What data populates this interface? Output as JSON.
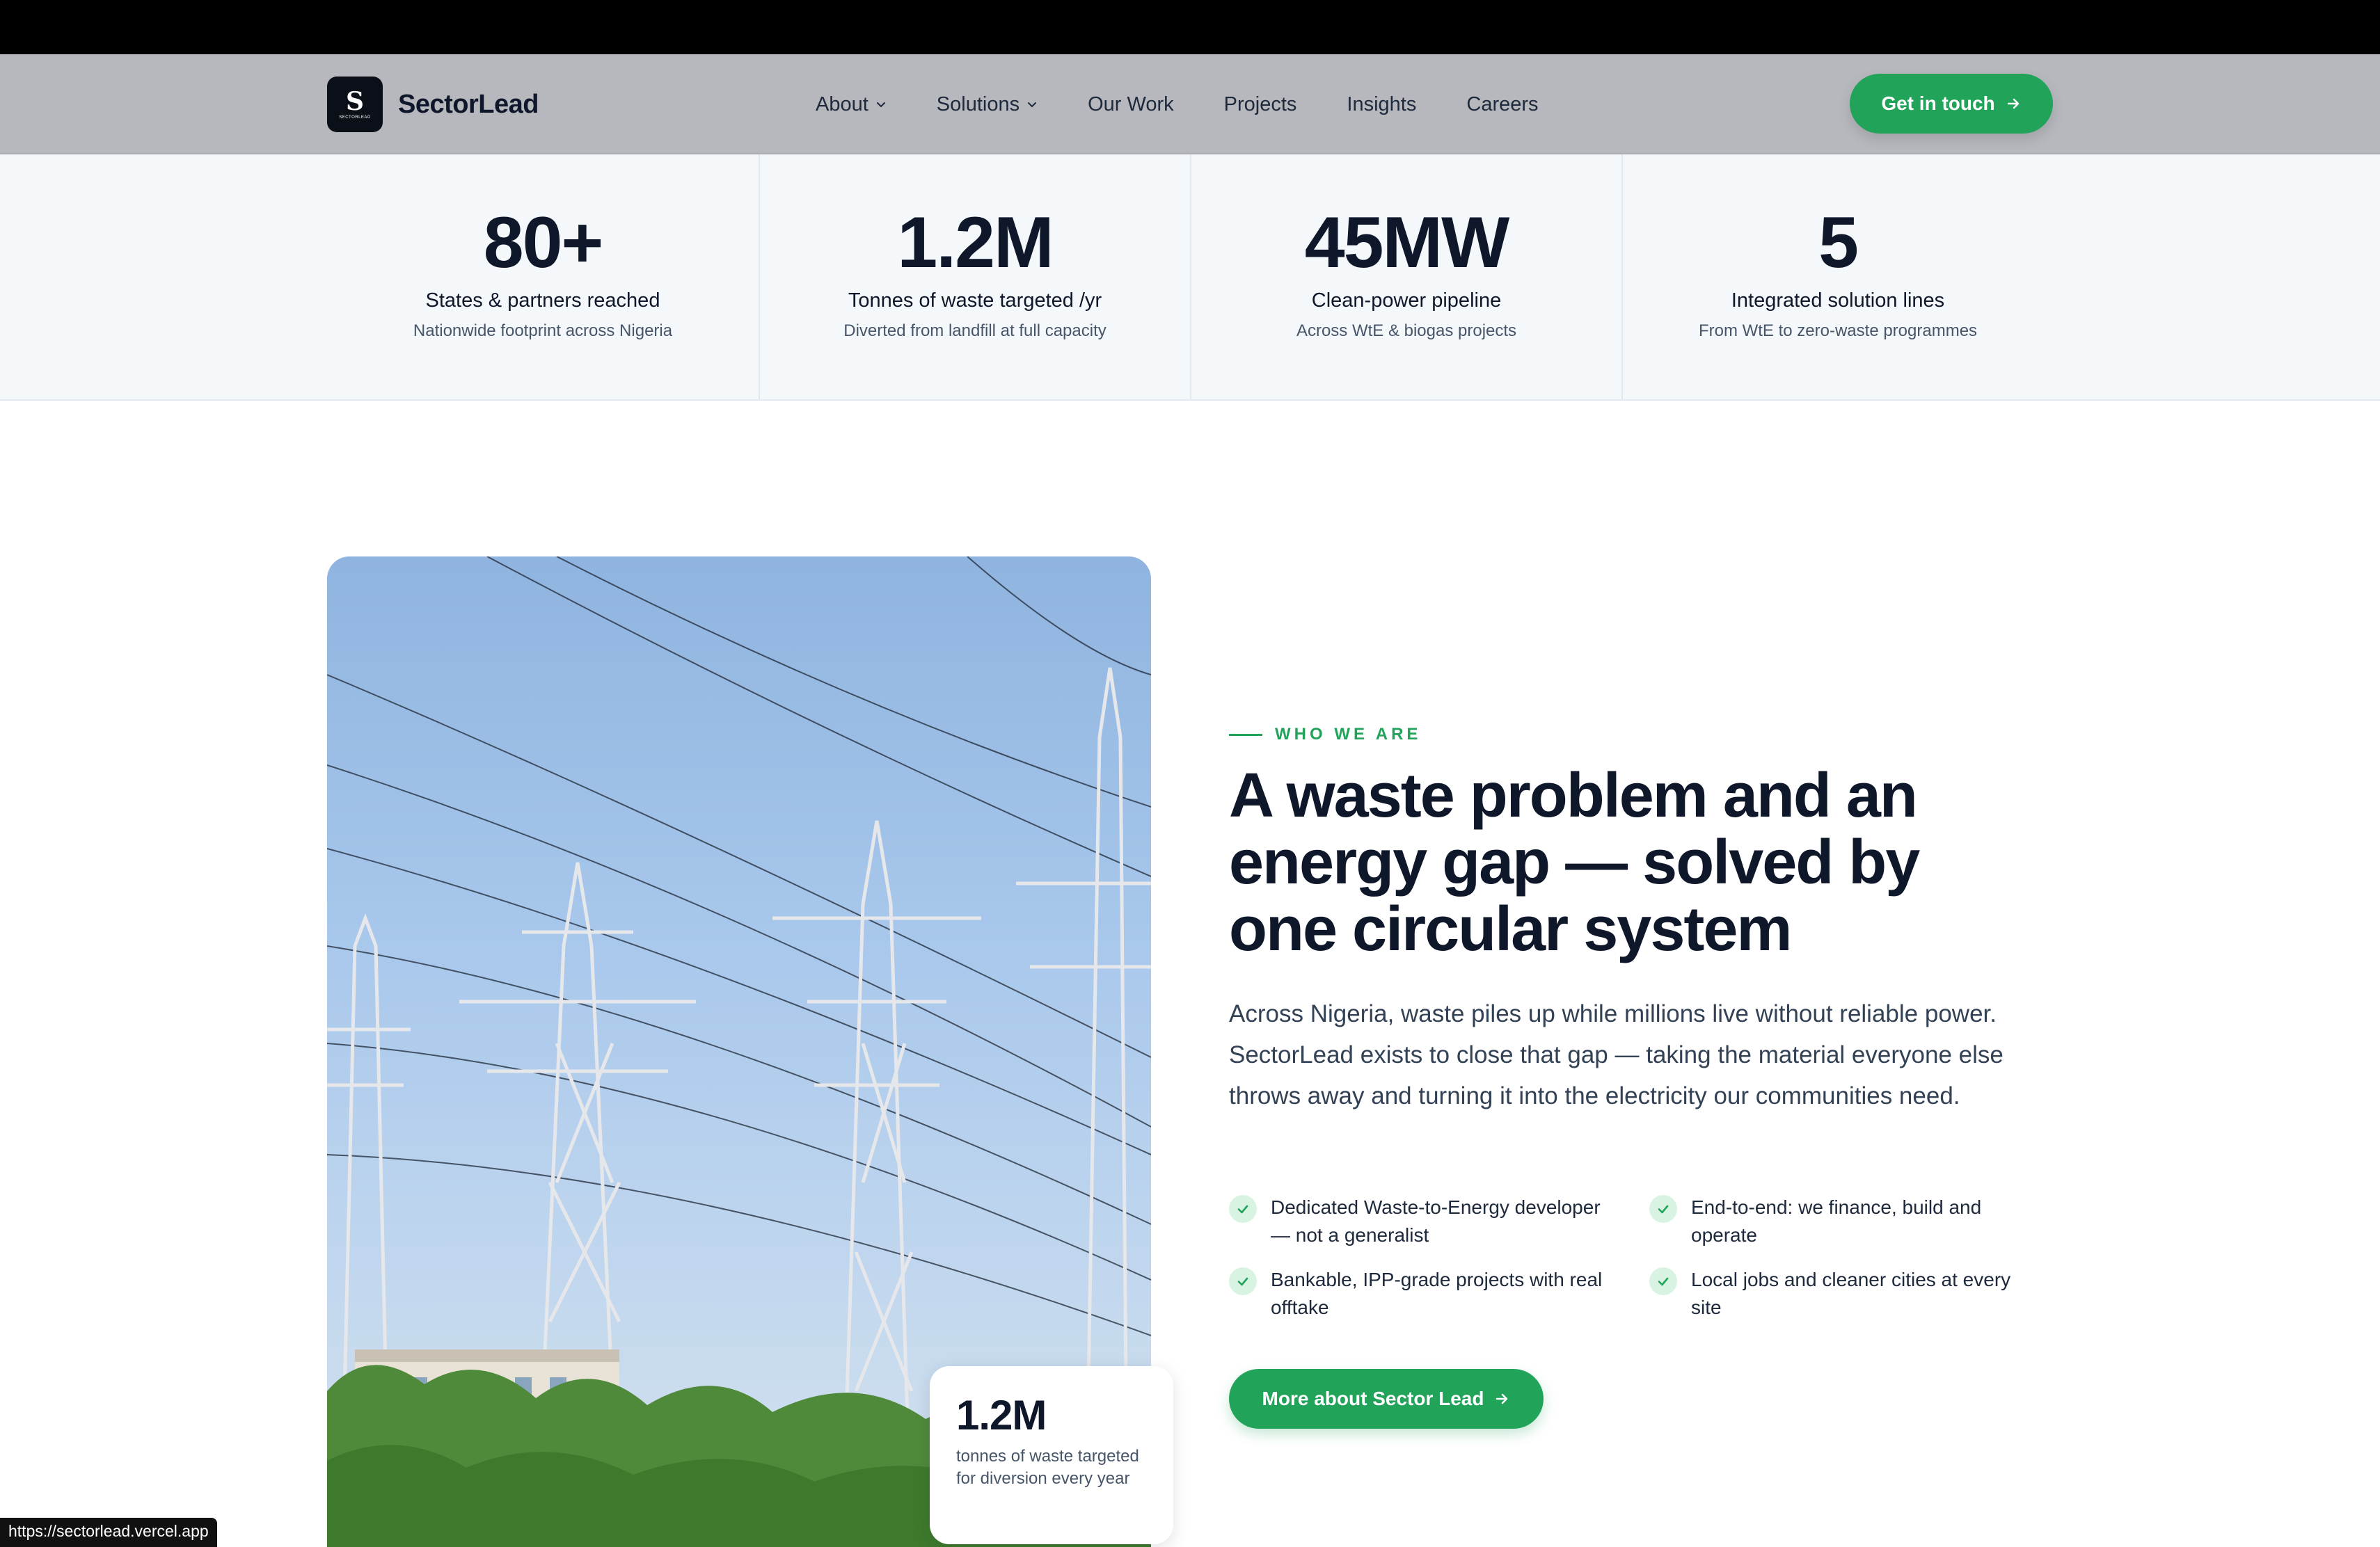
{
  "header": {
    "brand": "SectorLead",
    "logo_mark": "S",
    "logo_sub": "SECTORLEAD",
    "nav": [
      {
        "label": "About",
        "dropdown": true
      },
      {
        "label": "Solutions",
        "dropdown": true
      },
      {
        "label": "Our Work",
        "dropdown": false
      },
      {
        "label": "Projects",
        "dropdown": false
      },
      {
        "label": "Insights",
        "dropdown": false
      },
      {
        "label": "Careers",
        "dropdown": false
      }
    ],
    "cta_label": "Get in touch"
  },
  "stats": [
    {
      "value": "80+",
      "label": "States & partners reached",
      "sub": "Nationwide footprint across Nigeria"
    },
    {
      "value": "1.2M",
      "label": "Tonnes of waste targeted /yr",
      "sub": "Diverted from landfill at full capacity"
    },
    {
      "value": "45MW",
      "label": "Clean-power pipeline",
      "sub": "Across WtE & biogas projects"
    },
    {
      "value": "5",
      "label": "Integrated solution lines",
      "sub": "From WtE to zero-waste programmes"
    }
  ],
  "about": {
    "eyebrow": "WHO WE ARE",
    "heading": "A waste problem and an energy gap — solved by one circular system",
    "paragraph": "Across Nigeria, waste piles up while millions live without reliable power. SectorLead exists to close that gap — taking the material everyone else throws away and turning it into the electricity our communities need.",
    "checks": [
      "Dedicated Waste-to-Energy developer — not a generalist",
      "End-to-end: we finance, build and operate",
      "Bankable, IPP-grade projects with real offtake",
      "Local jobs and cleaner cities at every site"
    ],
    "button_label": "More about Sector Lead",
    "photo_card": {
      "value": "1.2M",
      "text": "tonnes of waste targeted for diversion every year"
    }
  },
  "status_url": "https://sectorlead.vercel.app",
  "colors": {
    "accent": "#22a35a",
    "navy": "#0f172a",
    "nav_bg": "#b6b8bd"
  }
}
